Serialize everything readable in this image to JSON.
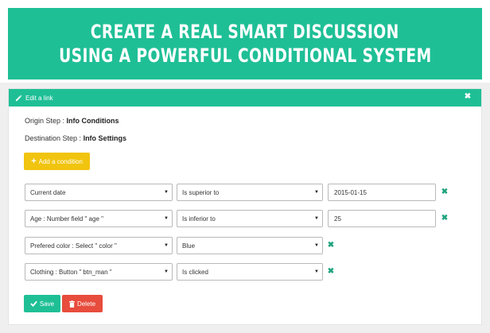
{
  "banner": {
    "line1": "CREATE A REAL SMART DISCUSSION",
    "line2": "USING A POWERFUL CONDITIONAL SYSTEM"
  },
  "panel": {
    "title": "Edit a link",
    "origin_label": "Origin Step :",
    "origin_value": "Info Conditions",
    "destination_label": "Destination Step :",
    "destination_value": "Info Settings",
    "add_condition_label": "Add a condition"
  },
  "conditions": [
    {
      "field": "Current date",
      "operator": "Is superior to",
      "value": "2015-01-15"
    },
    {
      "field": "Age : Number field \" age \"",
      "operator": "Is inferior to",
      "value": "25"
    },
    {
      "field": "Prefered color : Select \" color \"",
      "operator": "Blue"
    },
    {
      "field": "Clothing : Button \" btn_man \"",
      "operator": "Is clicked"
    }
  ],
  "actions": {
    "save_label": "Save",
    "delete_label": "Delete"
  },
  "colors": {
    "accent": "#1fbf96",
    "warning": "#f1c40f",
    "danger": "#e74c3c"
  },
  "icons": {
    "header": "pencil-icon",
    "close": "close-icon",
    "add": "plus-icon",
    "remove": "remove-condition-icon",
    "select": "caret-down-icon",
    "save": "check-icon",
    "delete": "trash-icon"
  }
}
